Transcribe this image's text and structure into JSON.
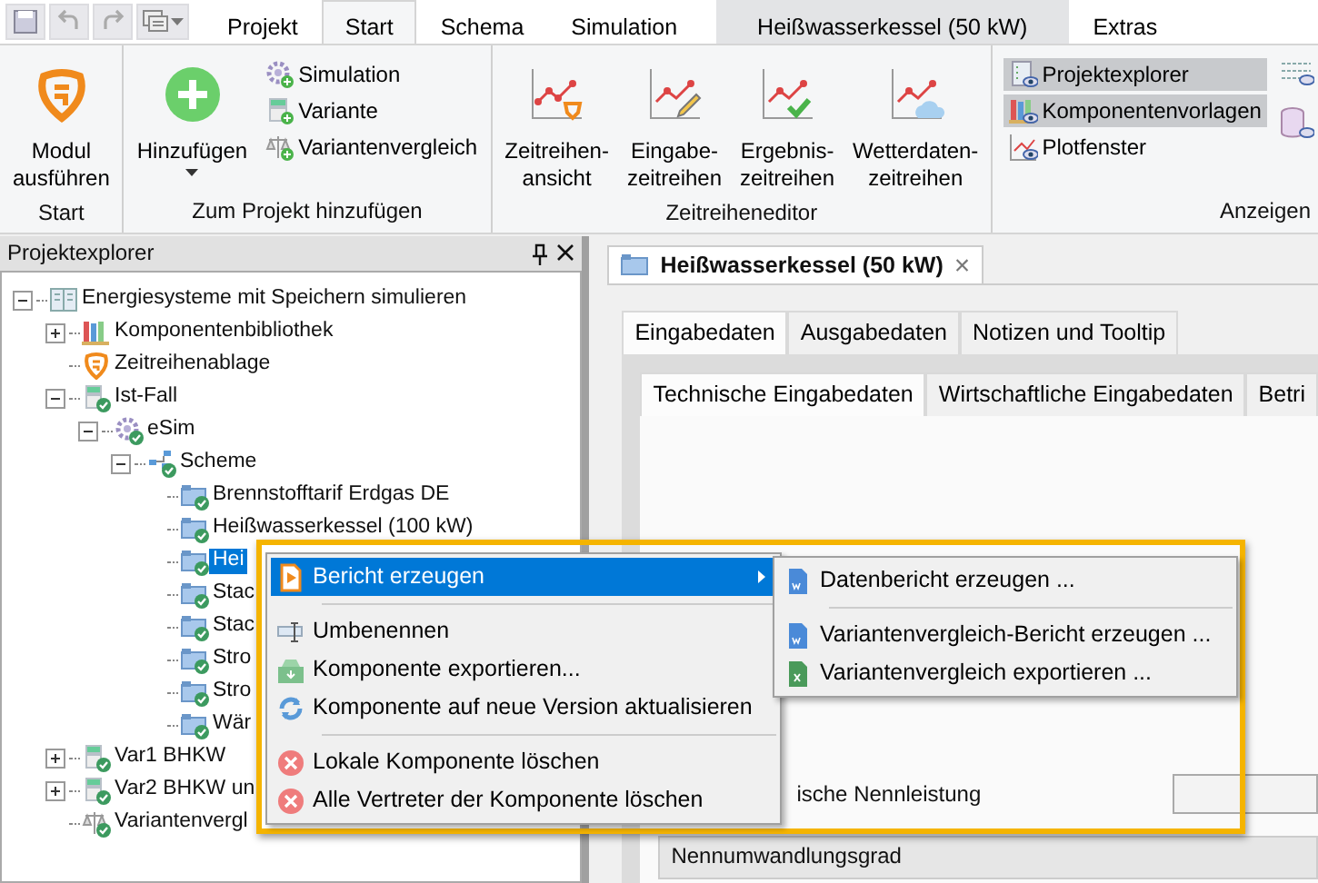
{
  "ribbon": {
    "tabs": [
      {
        "label": "Projekt",
        "selected": false,
        "contextual": false
      },
      {
        "label": "Start",
        "selected": true,
        "contextual": false
      },
      {
        "label": "Schema",
        "selected": false,
        "contextual": false
      },
      {
        "label": "Simulation",
        "selected": false,
        "contextual": false
      },
      {
        "label": "Heißwasserkessel (50 kW)",
        "selected": false,
        "contextual": true
      },
      {
        "label": "Extras",
        "selected": false,
        "contextual": false
      }
    ],
    "groups": [
      {
        "title": "Start",
        "buttons": [
          {
            "kind": "big",
            "label": "Modul\nausführen",
            "pressed": false
          }
        ]
      },
      {
        "title": "Zum Projekt hinzufügen",
        "buttons": [
          {
            "kind": "dropdown",
            "label": "Hinzufügen",
            "pressed": false
          },
          {
            "kind": "small",
            "label": "Simulation",
            "pressed": false
          },
          {
            "kind": "small",
            "label": "Variante",
            "pressed": false
          },
          {
            "kind": "small",
            "label": "Variantenvergleich",
            "pressed": false
          }
        ]
      },
      {
        "title": "Zeitreiheneditor",
        "buttons": [
          {
            "kind": "big",
            "label": "Zeitreihen-\nansicht",
            "pressed": false
          },
          {
            "kind": "big",
            "label": "Eingabe-\nzeitreihen",
            "pressed": false
          },
          {
            "kind": "big",
            "label": "Ergebnis-\nzeitreihen",
            "pressed": false
          },
          {
            "kind": "big",
            "label": "Wetterdaten-\nzeitreihen",
            "pressed": false
          }
        ]
      },
      {
        "title": "Anzeigen",
        "buttons": [
          {
            "kind": "small",
            "label": "Projektexplorer",
            "pressed": true
          },
          {
            "kind": "small",
            "label": "Komponentenvorlagen",
            "pressed": true
          },
          {
            "kind": "small",
            "label": "Plotfenster",
            "pressed": false
          }
        ]
      }
    ]
  },
  "explorer": {
    "title": "Projektexplorer",
    "tree": [
      {
        "label": "Energiesysteme mit Speichern simulieren",
        "kind": "project",
        "expanded": true,
        "selected": false,
        "children": [
          {
            "label": "Komponentenbibliothek",
            "kind": "library",
            "expanded": false,
            "selected": false
          },
          {
            "label": "Zeitreihenablage",
            "kind": "storage",
            "selected": false
          },
          {
            "label": "Ist-Fall",
            "kind": "variant",
            "expanded": true,
            "selected": false,
            "children": [
              {
                "label": "eSim",
                "kind": "simulation",
                "expanded": true,
                "selected": false,
                "children": [
                  {
                    "label": "Scheme",
                    "kind": "scheme",
                    "expanded": true,
                    "selected": false,
                    "children": [
                      {
                        "label": "Brennstofftarif Erdgas DE",
                        "kind": "component",
                        "selected": false
                      },
                      {
                        "label": "Heißwasserkessel (100 kW)",
                        "kind": "component",
                        "selected": false
                      },
                      {
                        "label": "Hei",
                        "kind": "component",
                        "selected": true
                      },
                      {
                        "label": "Stac",
                        "kind": "component",
                        "selected": false
                      },
                      {
                        "label": "Stac",
                        "kind": "component",
                        "selected": false
                      },
                      {
                        "label": "Stro",
                        "kind": "component",
                        "selected": false
                      },
                      {
                        "label": "Stro",
                        "kind": "component",
                        "selected": false
                      },
                      {
                        "label": "Wär",
                        "kind": "component",
                        "selected": false
                      }
                    ]
                  }
                ]
              }
            ]
          },
          {
            "label": "Var1 BHKW",
            "kind": "variant",
            "expanded": false,
            "selected": false
          },
          {
            "label": "Var2 BHKW un",
            "kind": "variant",
            "expanded": false,
            "selected": false
          },
          {
            "label": "Variantenvergl",
            "kind": "comparison",
            "selected": false
          }
        ]
      }
    ]
  },
  "document": {
    "tab": "Heißwasserkessel (50 kW)",
    "close": "×",
    "tabs": [
      {
        "label": "Eingabedaten",
        "selected": true
      },
      {
        "label": "Ausgabedaten",
        "selected": false
      },
      {
        "label": "Notizen und Tooltip",
        "selected": false
      }
    ],
    "subtabs": [
      {
        "label": "Technische Eingabedaten",
        "selected": true
      },
      {
        "label": "Wirtschaftliche Eingabedaten",
        "selected": false
      },
      {
        "label": "Betri",
        "selected": false
      }
    ],
    "fields": [
      {
        "kind": "input",
        "label": "ische Nennleistung"
      },
      {
        "kind": "header",
        "label": "Nennumwandlungsgrad"
      }
    ]
  },
  "context_menu": {
    "items": [
      {
        "kind": "report",
        "label": "Bericht erzeugen",
        "selected": true
      },
      {
        "kind": "separator"
      },
      {
        "kind": "rename",
        "label": "Umbenennen",
        "selected": false
      },
      {
        "kind": "export",
        "label": "Komponente exportieren...",
        "selected": false
      },
      {
        "kind": "update",
        "label": "Komponente auf neue Version aktualisieren",
        "selected": false
      },
      {
        "kind": "separator"
      },
      {
        "kind": "delete",
        "label": "Lokale Komponente löschen",
        "selected": false
      },
      {
        "kind": "delete",
        "label": "Alle Vertreter der Komponente löschen",
        "selected": false
      }
    ],
    "submenu": [
      {
        "kind": "word",
        "label": "Datenbericht erzeugen ..."
      },
      {
        "kind": "separator"
      },
      {
        "kind": "word",
        "label": "Variantenvergleich-Bericht erzeugen ..."
      },
      {
        "kind": "excel",
        "label": "Variantenvergleich exportieren ..."
      }
    ]
  }
}
